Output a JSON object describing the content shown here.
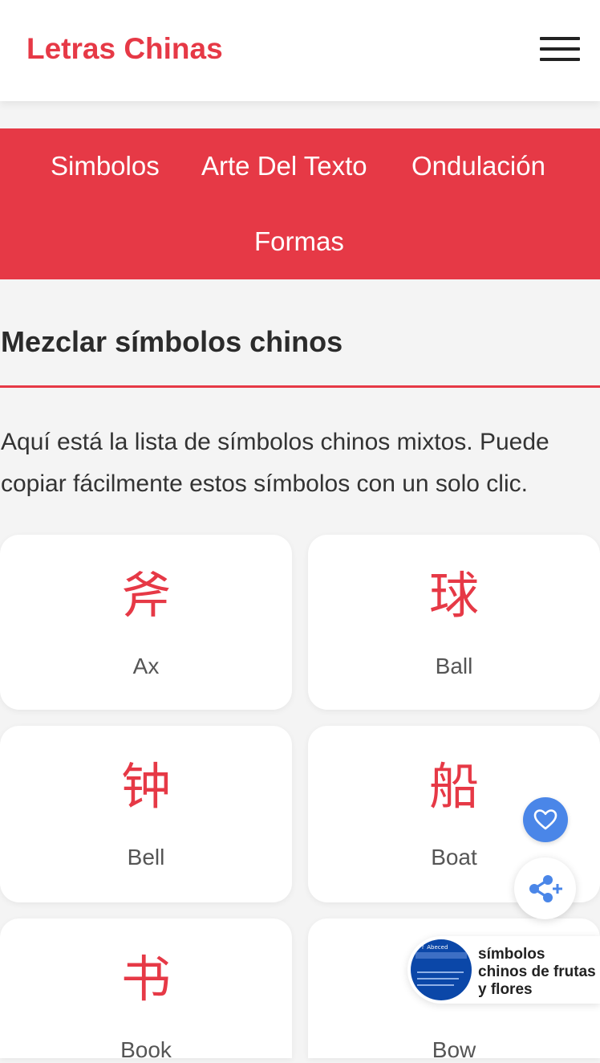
{
  "header": {
    "logo": "Letras Chinas",
    "menu_icon": "hamburger-menu-icon"
  },
  "nav": {
    "items": [
      {
        "label": "Simbolos"
      },
      {
        "label": "Arte Del Texto"
      },
      {
        "label": "Ondulación"
      },
      {
        "label": "Formas"
      }
    ]
  },
  "main": {
    "title": "Mezclar símbolos chinos",
    "intro_line1": "Aquí está la lista de símbolos chinos mixtos. Puede",
    "intro_line2": "copiar fácilmente estos símbolos con un solo clic.",
    "cards": [
      {
        "symbol": "斧",
        "name": "Ax"
      },
      {
        "symbol": "球",
        "name": "Ball"
      },
      {
        "symbol": "钟",
        "name": "Bell"
      },
      {
        "symbol": "船",
        "name": "Boat"
      },
      {
        "symbol": "书",
        "name": "Book"
      },
      {
        "symbol": "",
        "name": "Bow"
      }
    ]
  },
  "floating": {
    "heart_icon": "heart-icon",
    "share_icon": "share-plus-icon",
    "promo_thumb_caption": "as ↑ Abeced",
    "promo_text": "símbolos chinos de frutas y flores"
  },
  "colors": {
    "accent": "#e63946",
    "fab_blue": "#4a86e8",
    "background": "#f4f4f4"
  }
}
